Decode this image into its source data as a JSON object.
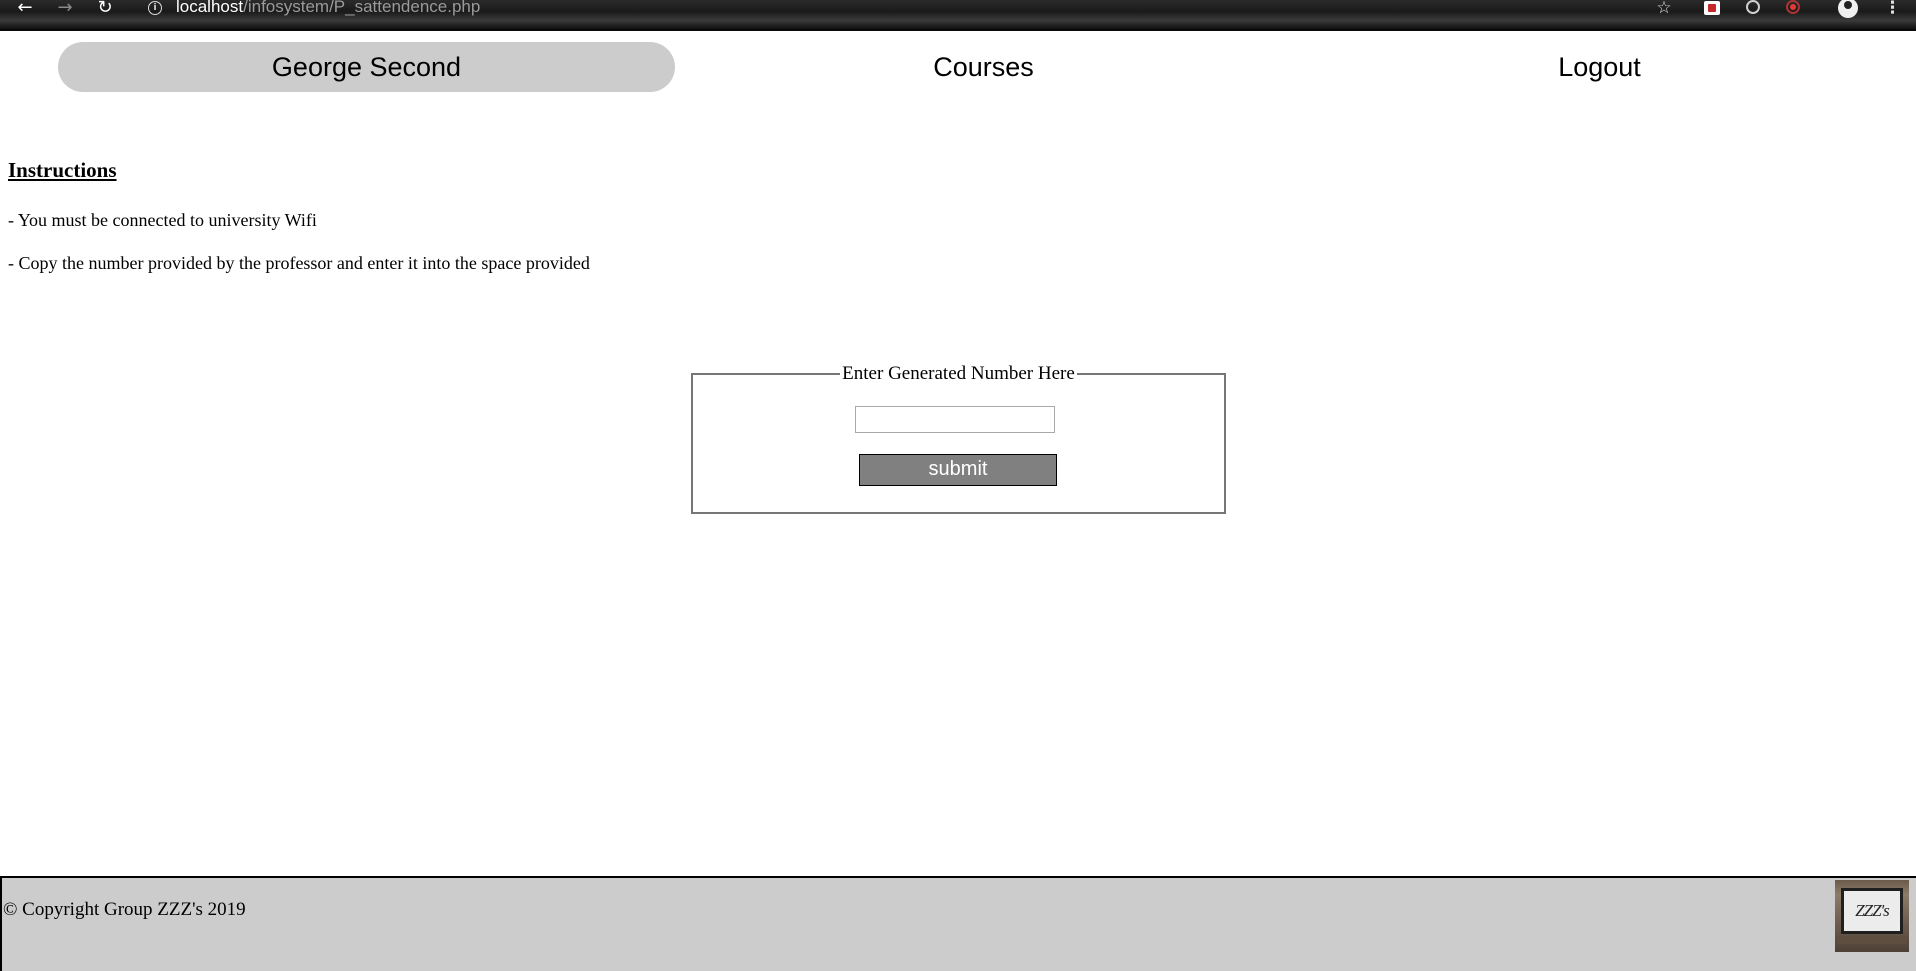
{
  "browser": {
    "url_host": "localhost",
    "url_path": "/infosystem/P_sattendence.php",
    "icons": [
      "back-arrow-icon",
      "forward-arrow-icon",
      "reload-icon",
      "info-icon",
      "star-icon",
      "extension-icon",
      "extension-icon",
      "extension-icon",
      "profile-icon",
      "menu-dots-icon"
    ]
  },
  "nav": {
    "user": "George Second",
    "courses": "Courses",
    "logout": "Logout"
  },
  "instructions": {
    "heading": "Instructions",
    "items": [
      "- You must be connected to university Wifi",
      "- Copy the number provided by the professor and enter it into the space provided"
    ]
  },
  "form": {
    "legend": "Enter Generated Number Here",
    "input_value": "",
    "submit_label": "submit"
  },
  "footer": {
    "copyright": "© Copyright Group ZZZ's 2019",
    "logo_text": "ZZZ's"
  },
  "colors": {
    "nav_active_bg": "#cccccc",
    "submit_bg": "#808080",
    "footer_bg": "#cccccc"
  }
}
